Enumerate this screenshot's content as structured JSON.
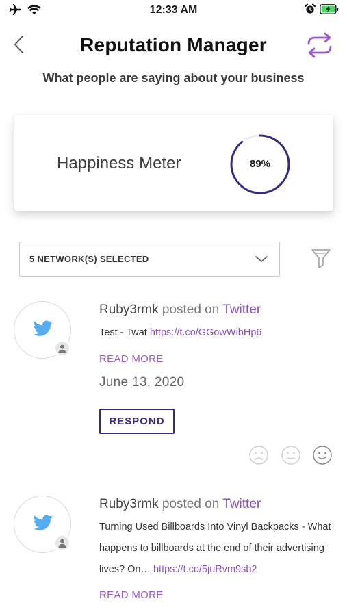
{
  "status_bar": {
    "time": "12:33 AM",
    "icons": [
      "airplane-icon",
      "wifi-icon",
      "alarm-icon",
      "battery-charging-icon"
    ]
  },
  "header": {
    "title": "Reputation Manager",
    "back_icon": "chevron-left-icon",
    "swap_icon": "swap-arrows-icon"
  },
  "subtitle": "What people are saying about your business",
  "happiness_meter": {
    "label": "Happiness Meter",
    "value_text": "89%",
    "value": 0.89,
    "accent_color": "#3b2a7a"
  },
  "network_filter": {
    "selected_label": "5 NETWORK(S) SELECTED",
    "filter_icon": "funnel-icon"
  },
  "colors": {
    "link": "#8a4fc4",
    "primary": "#3b2a7a",
    "twitter": "#55acee"
  },
  "reviews": [
    {
      "author": "Ruby3rmk",
      "posted_on": "posted on",
      "network": "Twitter",
      "text": "Test - Twat ",
      "link": "https://t.co/GGowWibHp6",
      "read_more": "READ MORE",
      "date": "June 13, 2020",
      "respond": "RESPOND",
      "sentiments": [
        "sad-face-icon",
        "neutral-face-icon",
        "happy-face-icon"
      ]
    },
    {
      "author": "Ruby3rmk",
      "posted_on": "posted on",
      "network": "Twitter",
      "text": "Turning Used Billboards Into Vinyl Backpacks - What happens to billboards at the end of their advertising lives? On… ",
      "link": "https://t.co/5juRvm9sb2",
      "read_more": "READ MORE"
    }
  ]
}
